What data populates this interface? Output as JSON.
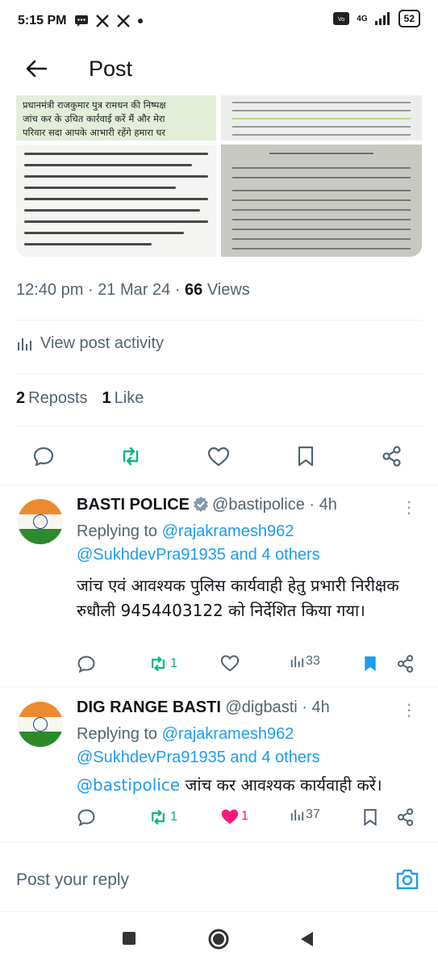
{
  "status_bar": {
    "time": "5:15 PM",
    "network": "4G",
    "battery": "52"
  },
  "header": {
    "title": "Post"
  },
  "media": {
    "image1_lines": [
      "प्रधानमंत्री राजकुमार पुत्र रामधन की निष्पक्ष",
      "जांच कर के उचित कार्रवाई करें मैं और मेरा",
      "परिवार सदा आपके आभारी रहेंगे हमारा घर"
    ]
  },
  "post_meta": {
    "time": "12:40 pm",
    "sep1": " · ",
    "date": "21 Mar 24",
    "sep2": " · ",
    "views": "66",
    "views_label": " Views"
  },
  "activity": {
    "label": "View post activity"
  },
  "stats": {
    "reposts": "2",
    "reposts_label": "Reposts",
    "likes": "1",
    "likes_label": "Like"
  },
  "replies": [
    {
      "name": "BASTI POLICE",
      "handle": "@bastipolice · 4h",
      "replying_prefix": "Replying to ",
      "replying_user": "@rajakramesh962",
      "replying_line2_user": "@SukhdevPra91935",
      "replying_line2_rest": " and 4 others",
      "text": "जांच एवं आवश्यक पुलिस कार्यवाही हेतु प्रभारी निरीक्षक रुधौली 9454403122 को निर्देशित किया गया।",
      "reposts": "1",
      "views": "33"
    },
    {
      "name": "DIG RANGE BASTI",
      "handle": "@digbasti · 4h",
      "replying_prefix": "Replying to ",
      "replying_user": "@rajakramesh962",
      "replying_line2_user": "@SukhdevPra91935",
      "replying_line2_rest": " and 4 others",
      "text_mention": "@bastipolice",
      "text_rest": " जांच कर आवश्यक कार्यवाही करें।",
      "reposts": "1",
      "likes": "1",
      "views": "37"
    }
  ],
  "reply_box": {
    "placeholder": "Post your reply"
  },
  "colors": {
    "accent": "#1d9bf0",
    "repost": "#00ba7c",
    "like": "#f91880",
    "muted": "#536471"
  }
}
